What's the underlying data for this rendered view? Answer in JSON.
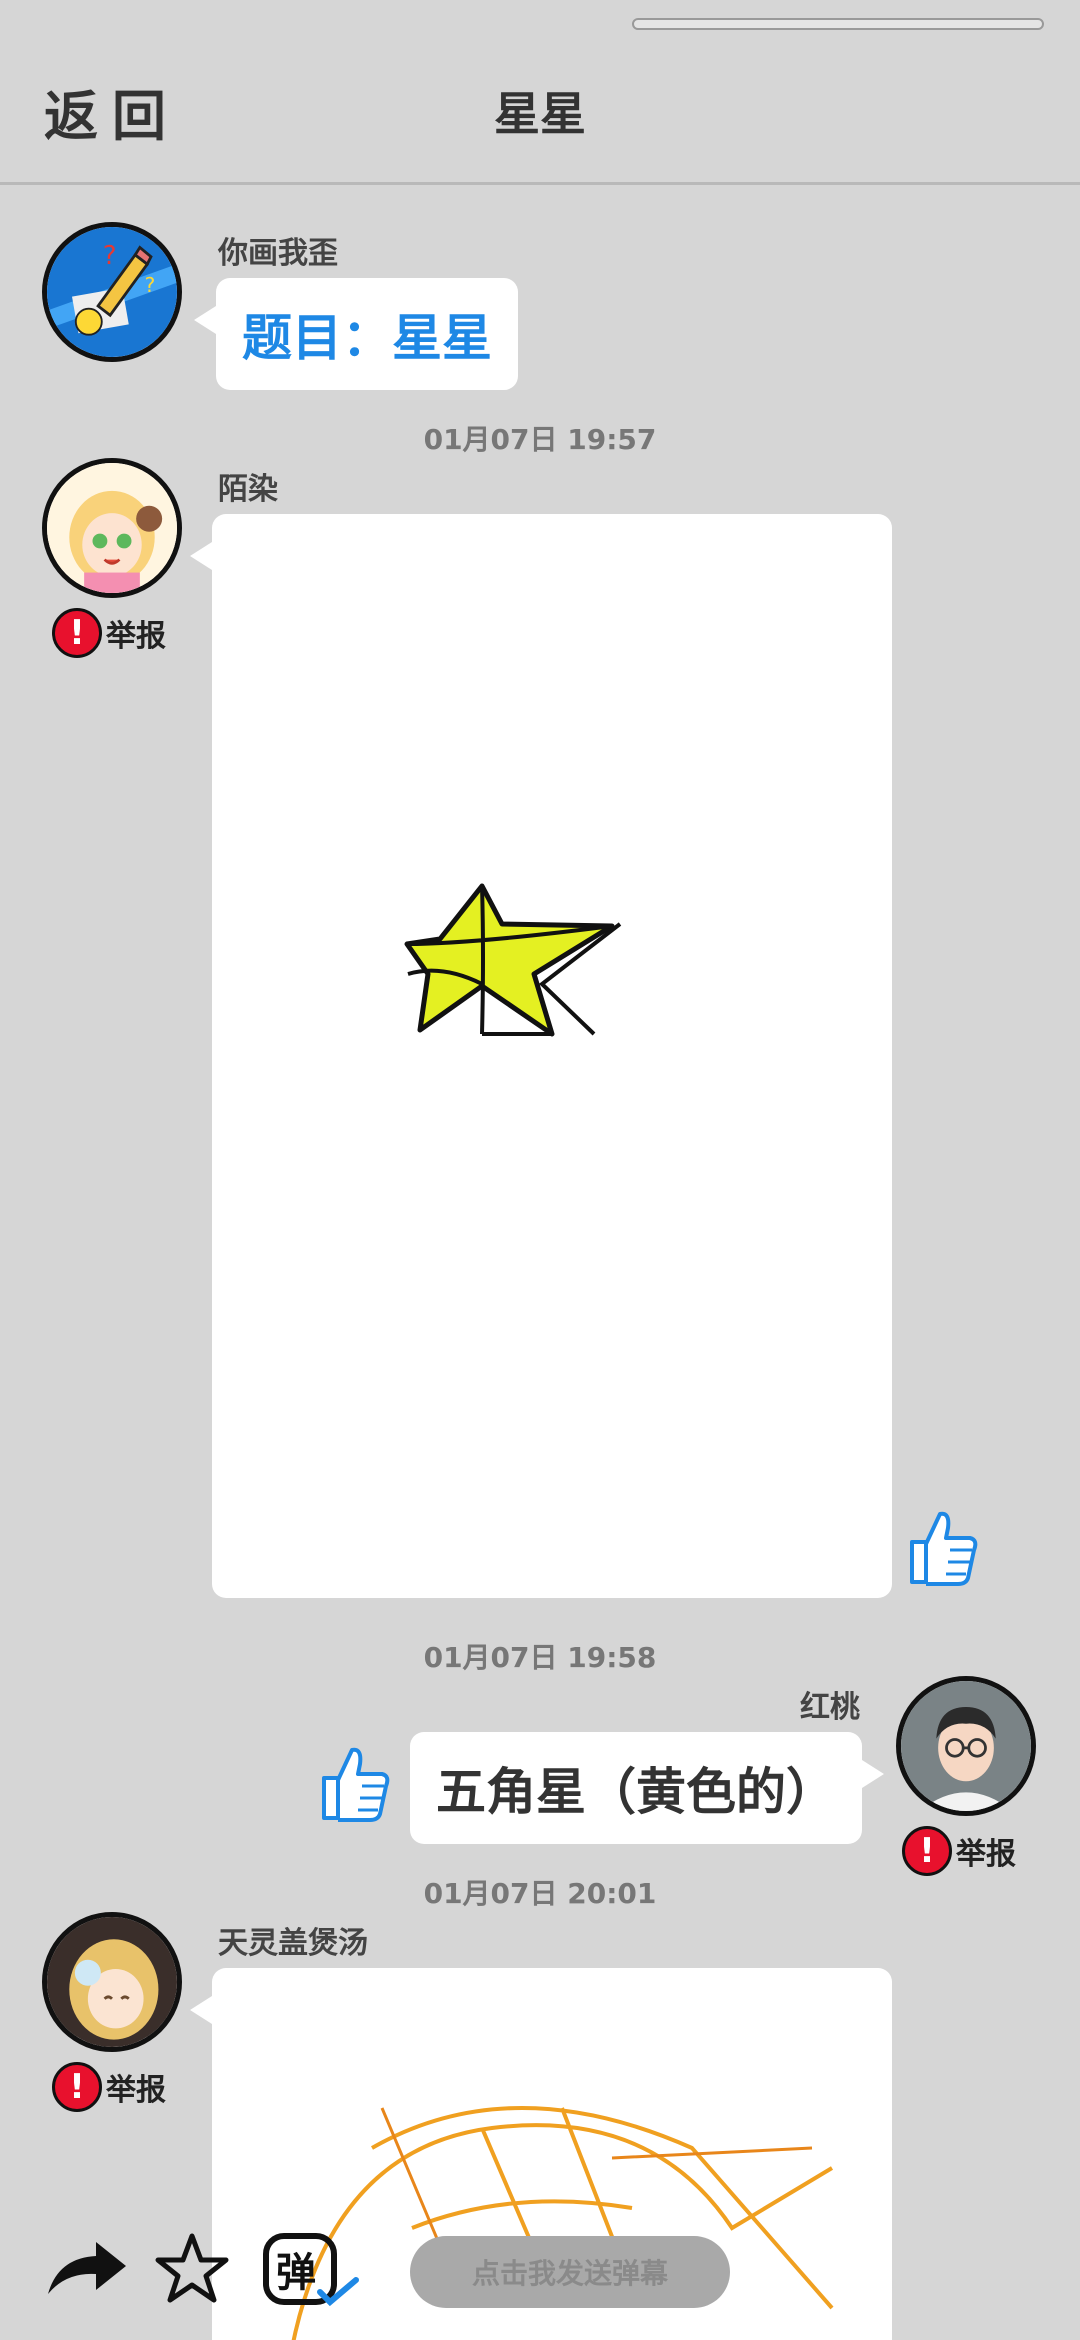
{
  "header": {
    "back_label": "返回",
    "title": "星星"
  },
  "messages": [
    {
      "user": "你画我歪",
      "text": "题目：星星",
      "text_color": "#1e88e5"
    },
    {
      "timestamp": "01月07日  19:57",
      "user": "陌染",
      "report_label": "举报",
      "drawing": "yellow-star"
    },
    {
      "timestamp": "01月07日  19:58",
      "user": "红桃",
      "text": "五角星（黄色的）",
      "report_label": "举报"
    },
    {
      "timestamp": "01月07日  20:01",
      "user": "天灵盖煲汤",
      "report_label": "举报",
      "drawing": "orange-scribble"
    }
  ],
  "bottom_bar": {
    "danmaku_placeholder": "点击我发送弹幕",
    "danmaku_toggle_label": "弹",
    "icons": [
      "share-icon",
      "star-icon",
      "danmaku-toggle-icon"
    ]
  },
  "colors": {
    "background": "#d6d6d6",
    "accent_blue": "#1e88e5",
    "report_red": "#e8112d",
    "star_fill": "#e4f022"
  }
}
